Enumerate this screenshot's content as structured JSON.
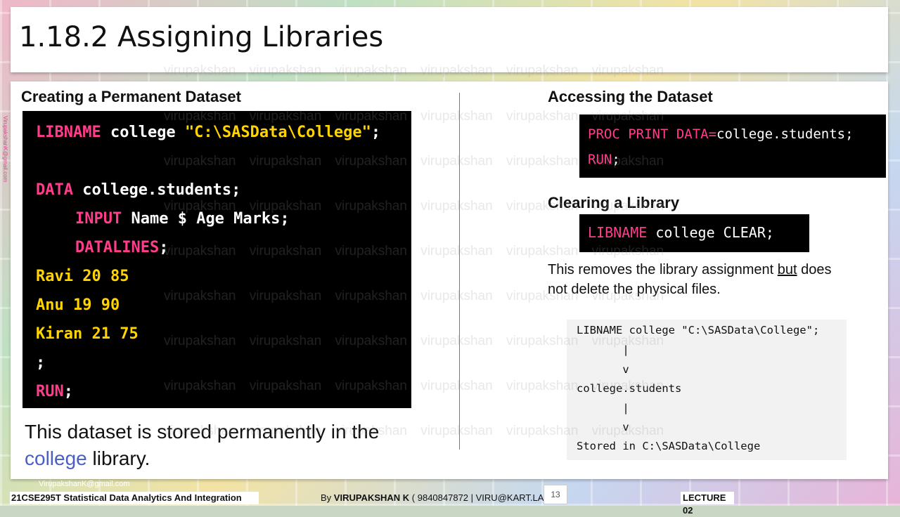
{
  "slide": {
    "title": "1.18.2 Assigning Libraries",
    "left": {
      "heading": "Creating a Permanent Dataset",
      "code": {
        "l1_kw": "LIBNAME",
        "l1_rest": " college ",
        "l1_str": "\"C:\\SASData\\College\"",
        "l1_end": ";",
        "l2_kw": "DATA",
        "l2_rest": " college.students;",
        "l3_kw": "INPUT",
        "l3_rest": " Name $ Age Marks;",
        "l4_kw": "DATALINES",
        "l4_end": ";",
        "l5": "Ravi 20 85",
        "l6": "Anu 19 90",
        "l7": "Kiran 21 75",
        "l8": ";",
        "l9_kw": "RUN",
        "l9_end": ";"
      },
      "note_before": "This dataset is stored permanently in the ",
      "note_accent": "college",
      "note_after": " library."
    },
    "right": {
      "heading_access": "Accessing the Dataset",
      "access_code": {
        "l1_kw": "PROC PRINT DATA",
        "l1_eq": "=",
        "l1_rest": "college.students;",
        "l2_kw": "RUN",
        "l2_end": ";"
      },
      "heading_clear": "Clearing a Library",
      "clear_code": {
        "kw": "LIBNAME",
        "rest": " college CLEAR;"
      },
      "clear_note_a": "This removes the library assignment ",
      "clear_note_u": "but",
      "clear_note_b": " does",
      "clear_note_c": "not delete the physical files.",
      "flow": [
        "LIBNAME college \"C:\\SASData\\College\";",
        "       |",
        "       v",
        "college.students",
        "       |",
        "       v",
        "Stored in C:\\SASData\\College"
      ]
    }
  },
  "footer": {
    "course": "21CSE295T Statistical Data Analytics And Integration",
    "by": "By ",
    "author": "VIRUPAKSHAN K",
    "contact": " ( 9840847872 | VIRU@KART.LA",
    "page": "13",
    "lecture": "LECTURE 02"
  },
  "watermark": {
    "word": "virupakshan",
    "email": "VirupakshanK@gmail.com"
  }
}
